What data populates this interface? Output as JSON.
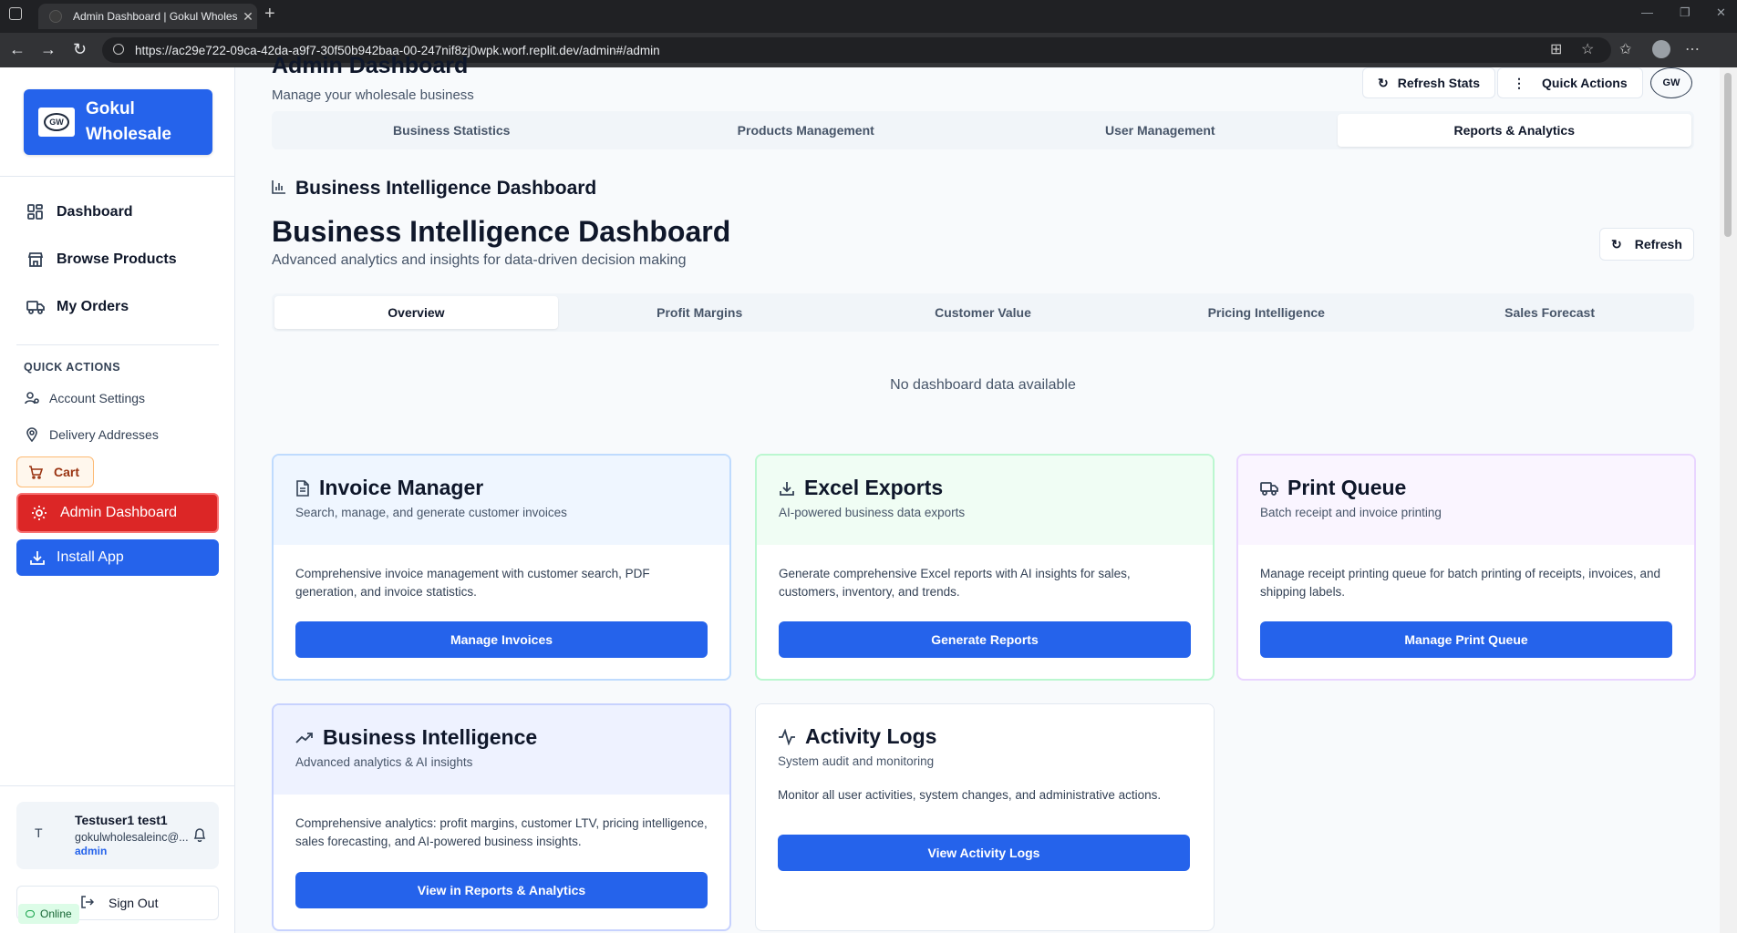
{
  "browser": {
    "tab_title": "Admin Dashboard | Gokul Wholes",
    "url": "https://ac29e722-09ca-42da-a9f7-30f50b942baa-00-247nif8zj0wpk.worf.replit.dev/admin#/admin"
  },
  "sidebar": {
    "brand_line1": "Gokul",
    "brand_line2": "Wholesale",
    "logo_text": "GW",
    "nav": [
      {
        "label": "Dashboard",
        "icon": "grid-icon"
      },
      {
        "label": "Browse Products",
        "icon": "store-icon"
      },
      {
        "label": "My Orders",
        "icon": "truck-icon"
      }
    ],
    "quick_actions_title": "QUICK ACTIONS",
    "quick_actions": [
      {
        "label": "Account Settings",
        "icon": "user-cog-icon"
      },
      {
        "label": "Delivery Addresses",
        "icon": "map-pin-icon"
      }
    ],
    "cart_label": "Cart",
    "admin_label": "Admin Dashboard",
    "install_label": "Install App",
    "user": {
      "avatar": "T",
      "name": "Testuser1 test1",
      "email": "gokulwholesaleinc@...",
      "role": "admin"
    },
    "signout_label": "Sign Out",
    "online_label": "Online"
  },
  "header": {
    "title": "Admin Dashboard",
    "subtitle": "Manage your wholesale business",
    "refresh_stats": "Refresh Stats",
    "quick_actions": "Quick Actions",
    "avatar": "GW",
    "tabs": [
      "Business Statistics",
      "Products Management",
      "User Management",
      "Reports & Analytics"
    ],
    "active_tab": 3
  },
  "bi": {
    "section_heading": "Business Intelligence Dashboard",
    "title": "Business Intelligence Dashboard",
    "subtitle": "Advanced analytics and insights for data-driven decision making",
    "refresh": "Refresh",
    "tabs": [
      "Overview",
      "Profit Margins",
      "Customer Value",
      "Pricing Intelligence",
      "Sales Forecast"
    ],
    "active_tab": 0,
    "empty_message": "No dashboard data available"
  },
  "cards": [
    {
      "title": "Invoice Manager",
      "desc": "Search, manage, and generate customer invoices",
      "body": "Comprehensive invoice management with customer search, PDF generation, and invoice statistics.",
      "button": "Manage Invoices",
      "icon": "file-text-icon",
      "accent": "#bfdbfe",
      "head_bg": "#eff6ff"
    },
    {
      "title": "Excel Exports",
      "desc": "AI-powered business data exports",
      "body": "Generate comprehensive Excel reports with AI insights for sales, customers, inventory, and trends.",
      "button": "Generate Reports",
      "icon": "download-icon",
      "accent": "#bbf7d0",
      "head_bg": "#f0fdf4"
    },
    {
      "title": "Print Queue",
      "desc": "Batch receipt and invoice printing",
      "body": "Manage receipt printing queue for batch printing of receipts, invoices, and shipping labels.",
      "button": "Manage Print Queue",
      "icon": "truck-icon",
      "accent": "#e9d5ff",
      "head_bg": "#faf5ff"
    },
    {
      "title": "Business Intelligence",
      "desc": "Advanced analytics & AI insights",
      "body": "Comprehensive analytics: profit margins, customer LTV, pricing intelligence, sales forecasting, and AI-powered business insights.",
      "button": "View in Reports & Analytics",
      "icon": "trending-up-icon",
      "accent": "#c7d2fe",
      "head_bg": "#eef2ff"
    },
    {
      "title": "Activity Logs",
      "desc": "System audit and monitoring",
      "body": "Monitor all user activities, system changes, and administrative actions.",
      "button": "View Activity Logs",
      "icon": "activity-icon",
      "accent": "#e2e8f0",
      "head_bg": "#ffffff"
    }
  ]
}
